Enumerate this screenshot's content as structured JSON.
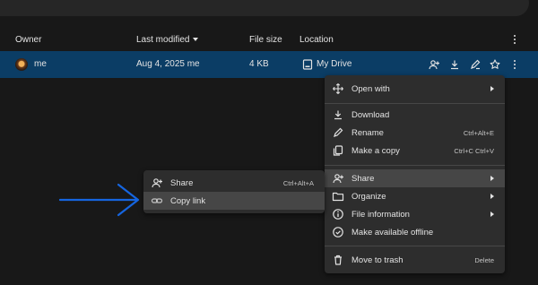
{
  "header": {
    "owner": "Owner",
    "last_modified": "Last modified",
    "file_size": "File size",
    "location": "Location"
  },
  "row": {
    "owner": "me",
    "modified": "Aug 4, 2025 me",
    "size": "4 KB",
    "location": "My Drive",
    "row_bg": "#0b3d65"
  },
  "context_menu": {
    "open_with": "Open with",
    "download": "Download",
    "rename": "Rename",
    "rename_shortcut": "Ctrl+Alt+E",
    "make_copy": "Make a copy",
    "make_copy_shortcut": "Ctrl+C Ctrl+V",
    "share": "Share",
    "organize": "Organize",
    "file_information": "File information",
    "offline": "Make available offline",
    "trash": "Move to trash",
    "trash_shortcut": "Delete"
  },
  "share_submenu": {
    "share": "Share",
    "share_shortcut": "Ctrl+Alt+A",
    "copy_link": "Copy link"
  },
  "annotation": {
    "arrow_color": "#1565e0"
  }
}
